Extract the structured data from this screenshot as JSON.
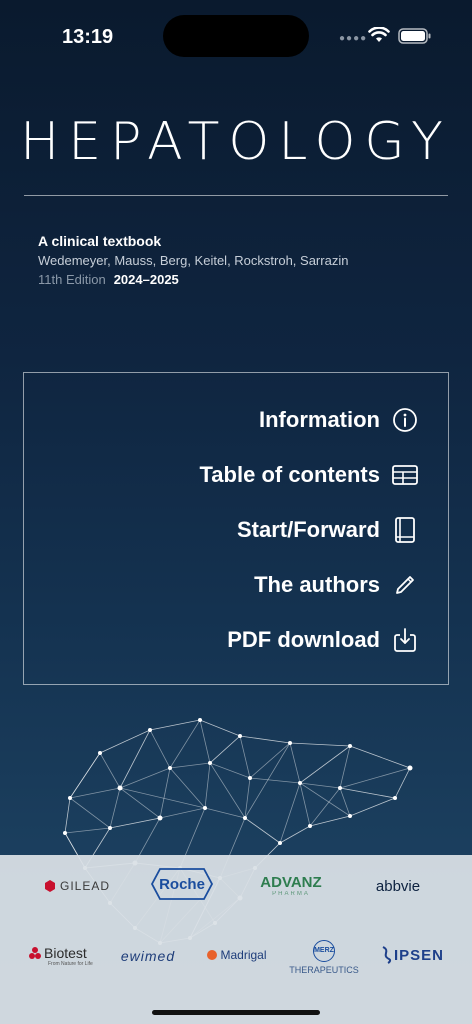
{
  "status_bar": {
    "time": "13:19",
    "icons": [
      "signal-dots-icon",
      "wifi-icon",
      "battery-icon"
    ]
  },
  "header": {
    "title": "HEPATOLOGY",
    "subtitle": "A clinical textbook",
    "authors": "Wedemeyer, Mauss, Berg, Keitel, Rockstroh, Sarrazin",
    "edition": "11th Edition",
    "years": "2024–2025"
  },
  "menu": {
    "items": [
      {
        "label": "Information",
        "icon": "info-icon"
      },
      {
        "label": "Table of contents",
        "icon": "table-icon"
      },
      {
        "label": "Start/Forward",
        "icon": "book-icon"
      },
      {
        "label": "The authors",
        "icon": "pencil-icon"
      },
      {
        "label": "PDF download",
        "icon": "download-icon"
      }
    ]
  },
  "sponsors": {
    "gilead": "GILEAD",
    "roche": "Roche",
    "advanz": "ADVANZ",
    "advanz_sub": "PHARMA",
    "abbvie": "abbvie",
    "biotest": "Biotest",
    "biotest_sub": "From Nature for Life",
    "ewimed": "ewimed",
    "madrigal": "Madrigal",
    "merz": "MERZ",
    "merz_sub": "THERAPEUTICS",
    "ipsen": "IPSEN"
  },
  "colors": {
    "background_top": "#0a1a2e",
    "background_bottom": "#22476a",
    "sponsor_bar": "#dae0e6",
    "roche_blue": "#1a4d9e",
    "gilead_red": "#c8102e",
    "advanz_green": "#2e7d4f",
    "madrigal_orange": "#e8622c"
  }
}
